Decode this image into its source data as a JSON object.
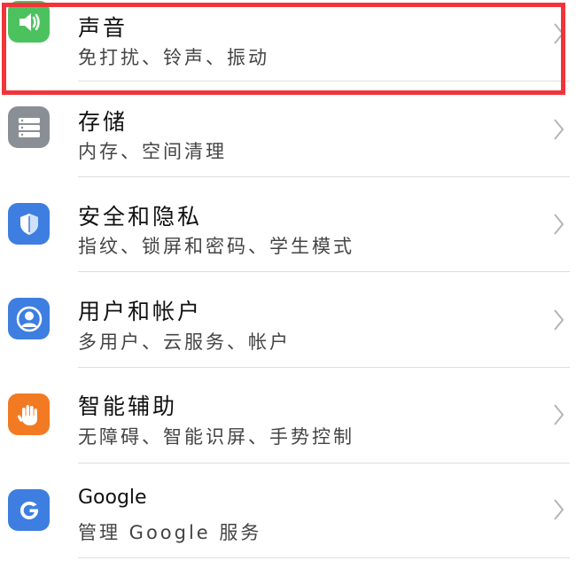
{
  "settings_items": [
    {
      "title": "声音",
      "subtitle": "免打扰、铃声、振动",
      "icon": "speaker-icon",
      "color": "#4cc25f"
    },
    {
      "title": "存储",
      "subtitle": "内存、空间清理",
      "icon": "storage-icon",
      "color": "#8a8f96"
    },
    {
      "title": "安全和隐私",
      "subtitle": "指纹、锁屏和密码、学生模式",
      "icon": "shield-icon",
      "color": "#3e7ee0"
    },
    {
      "title": "用户和帐户",
      "subtitle": "多用户、云服务、帐户",
      "icon": "user-icon",
      "color": "#3e7ee0"
    },
    {
      "title": "智能辅助",
      "subtitle": "无障碍、智能识屏、手势控制",
      "icon": "hand-icon",
      "color": "#f27a22"
    },
    {
      "title": "Google",
      "subtitle": "管理 Google 服务",
      "icon": "google-icon",
      "color": "#3e7ee0"
    }
  ],
  "highlight_color": "#f2343a"
}
